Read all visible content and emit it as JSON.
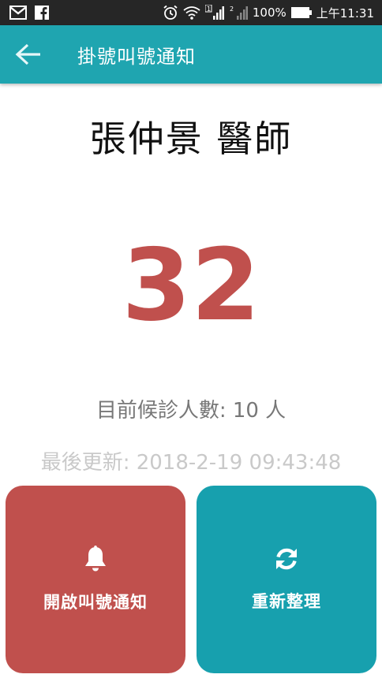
{
  "status_bar": {
    "battery": "100%",
    "time": "上午11:31",
    "sim1": "1",
    "sim2": "2"
  },
  "app_bar": {
    "title": "掛號叫號通知"
  },
  "main": {
    "doctor_name": "張仲景 醫師",
    "current_number": "32",
    "waiting_count": "目前候診人數: 10 人",
    "last_updated": "最後更新: 2018-2-19 09:43:48"
  },
  "actions": {
    "notify_label": "開啟叫號通知",
    "refresh_label": "重新整理"
  },
  "colors": {
    "primary": "#1fa5b0",
    "accent_red": "#c0504d",
    "refresh_teal": "#17a0ae",
    "status_bar": "#262626"
  },
  "icons": {
    "back": "arrow-left-icon",
    "notify": "bell-icon",
    "refresh": "refresh-icon"
  }
}
